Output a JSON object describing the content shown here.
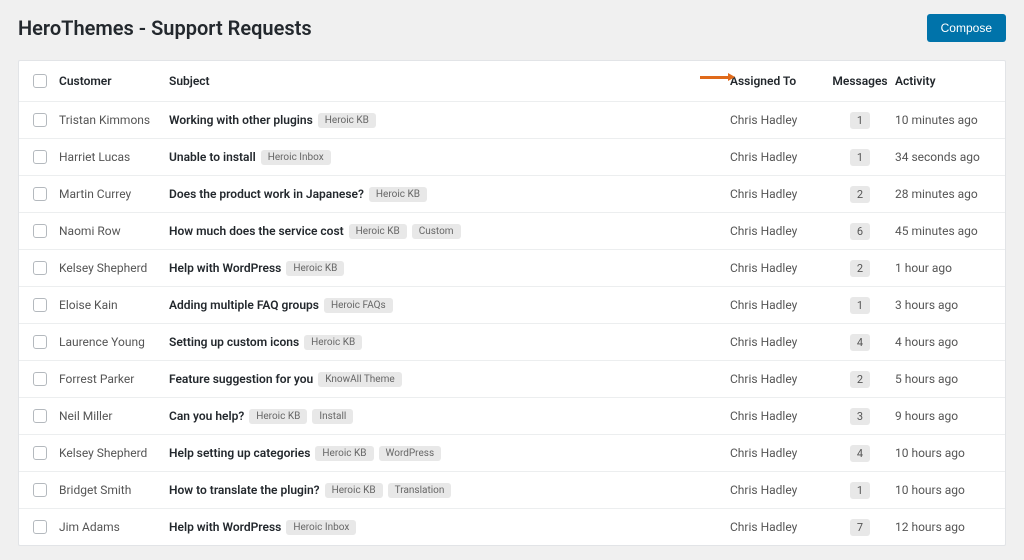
{
  "page_title": "HeroThemes - Support Requests",
  "compose_label": "Compose",
  "columns": {
    "customer": "Customer",
    "subject": "Subject",
    "assigned": "Assigned To",
    "messages": "Messages",
    "activity": "Activity"
  },
  "tickets": [
    {
      "customer": "Tristan Kimmons",
      "subject": "Working with other plugins",
      "tags": [
        "Heroic KB"
      ],
      "assigned": "Chris Hadley",
      "messages": "1",
      "activity": "10 minutes ago"
    },
    {
      "customer": "Harriet Lucas",
      "subject": "Unable to install",
      "tags": [
        "Heroic Inbox"
      ],
      "assigned": "Chris Hadley",
      "messages": "1",
      "activity": "34 seconds ago"
    },
    {
      "customer": "Martin Currey",
      "subject": "Does the product work in Japanese?",
      "tags": [
        "Heroic KB"
      ],
      "assigned": "Chris Hadley",
      "messages": "2",
      "activity": "28 minutes ago"
    },
    {
      "customer": "Naomi Row",
      "subject": "How much does the service cost",
      "tags": [
        "Heroic KB",
        "Custom"
      ],
      "assigned": "Chris Hadley",
      "messages": "6",
      "activity": "45 minutes ago"
    },
    {
      "customer": "Kelsey Shepherd",
      "subject": "Help with WordPress",
      "tags": [
        "Heroic KB"
      ],
      "assigned": "Chris Hadley",
      "messages": "2",
      "activity": "1 hour ago"
    },
    {
      "customer": "Eloise Kain",
      "subject": "Adding multiple FAQ groups",
      "tags": [
        "Heroic FAQs"
      ],
      "assigned": "Chris Hadley",
      "messages": "1",
      "activity": "3 hours ago"
    },
    {
      "customer": "Laurence Young",
      "subject": "Setting up custom icons",
      "tags": [
        "Heroic KB"
      ],
      "assigned": "Chris Hadley",
      "messages": "4",
      "activity": "4 hours ago"
    },
    {
      "customer": "Forrest Parker",
      "subject": "Feature suggestion for you",
      "tags": [
        "KnowAll Theme"
      ],
      "assigned": "Chris Hadley",
      "messages": "2",
      "activity": "5 hours ago"
    },
    {
      "customer": "Neil Miller",
      "subject": "Can you help?",
      "tags": [
        "Heroic KB",
        "Install"
      ],
      "assigned": "Chris Hadley",
      "messages": "3",
      "activity": "9 hours ago"
    },
    {
      "customer": "Kelsey Shepherd",
      "subject": "Help setting up categories",
      "tags": [
        "Heroic KB",
        "WordPress"
      ],
      "assigned": "Chris Hadley",
      "messages": "4",
      "activity": "10 hours ago"
    },
    {
      "customer": "Bridget Smith",
      "subject": "How to translate the plugin?",
      "tags": [
        "Heroic KB",
        "Translation"
      ],
      "assigned": "Chris Hadley",
      "messages": "1",
      "activity": "10 hours ago"
    },
    {
      "customer": "Jim Adams",
      "subject": "Help with WordPress",
      "tags": [
        "Heroic Inbox"
      ],
      "assigned": "Chris Hadley",
      "messages": "7",
      "activity": "12 hours ago"
    }
  ]
}
